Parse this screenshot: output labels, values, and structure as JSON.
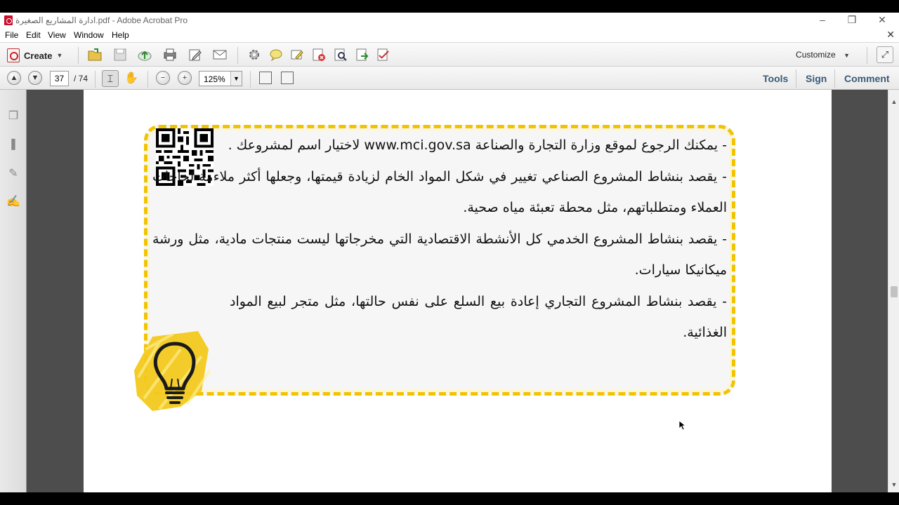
{
  "window": {
    "title": "ادارة المشاريع الصغيرة.pdf - Adobe Acrobat Pro",
    "controls": [
      "–",
      "❐",
      "✕"
    ]
  },
  "menu": {
    "items": [
      "File",
      "Edit",
      "View",
      "Window",
      "Help"
    ],
    "close_doc": "✕"
  },
  "toolbar": {
    "create_label": "Create",
    "customize_label": "Customize",
    "icons": [
      "open-icon",
      "save-icon",
      "cloud-upload-icon",
      "print-icon",
      "edit-icon",
      "email-icon",
      "settings-icon",
      "comment-icon",
      "highlight-icon",
      "delete-icon",
      "find-icon",
      "export-icon",
      "sign-icon"
    ]
  },
  "nav": {
    "current_page": "37",
    "total_pages": "/ 74",
    "zoom": "125%"
  },
  "panels": {
    "tools": "Tools",
    "sign": "Sign",
    "comment": "Comment"
  },
  "document": {
    "para1": "-  يمكنك الرجوع لموقع وزارة التجارة والصناعة www.mci.gov.sa لاختيار اسم لمشروعك .",
    "para2": "-  يقصد بنشاط المشروع الصناعي تغيير في شكل المواد الخام لزيادة قيمتها، وجعلها أكثر ملاءمة لحاجات العملاء ومتطلباتهم، مثل محطة تعبئة مياه صحية.",
    "para3": "-  يقصد بنشاط المشروع الخدمي كل الأنشطة الاقتصادية التي مخرجاتها ليست منتجات مادية، مثل ورشة ميكانيكا سيارات.",
    "para4": "-  يقصد بنشاط المشروع التجاري إعادة بيع السلع على نفس حالتها، مثل متجر لبيع المواد الغذائية.",
    "accent_color": "#f2c400"
  },
  "colors": {
    "tab_text": "#3a5a78",
    "workspace": "#4d4d4d"
  }
}
